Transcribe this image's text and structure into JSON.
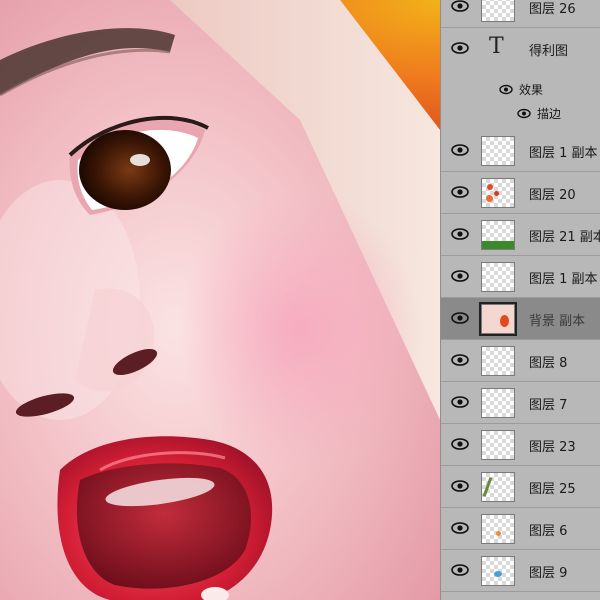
{
  "canvas": {
    "subject": "baby-face-artwork"
  },
  "colors": {
    "panel_bg": "#b5b5b5",
    "selected_row": "#8a8a8a",
    "skin": "#f2c4c4",
    "lip": "#d9243a"
  },
  "layers_panel": {
    "rows": [
      {
        "label": "图层 26",
        "kind": "raster",
        "selected": false
      },
      {
        "label": "得利图",
        "kind": "text",
        "selected": false
      },
      {
        "label": "图层 1 副本",
        "kind": "raster",
        "selected": false
      },
      {
        "label": "图层 20",
        "kind": "raster",
        "selected": false
      },
      {
        "label": "图层 21 副本",
        "kind": "raster",
        "selected": false
      },
      {
        "label": "图层 1 副本",
        "kind": "raster",
        "selected": false
      },
      {
        "label": "背景 副本",
        "kind": "raster",
        "selected": true
      },
      {
        "label": "图层 8",
        "kind": "raster",
        "selected": false
      },
      {
        "label": "图层 7",
        "kind": "raster",
        "selected": false
      },
      {
        "label": "图层 23",
        "kind": "raster",
        "selected": false
      },
      {
        "label": "图层 25",
        "kind": "raster",
        "selected": false
      },
      {
        "label": "图层 6",
        "kind": "raster",
        "selected": false
      },
      {
        "label": "图层 9",
        "kind": "raster",
        "selected": false
      }
    ],
    "effects": {
      "label": "效果",
      "stroke_label": "描边"
    },
    "text_layer_glyph": "T"
  }
}
